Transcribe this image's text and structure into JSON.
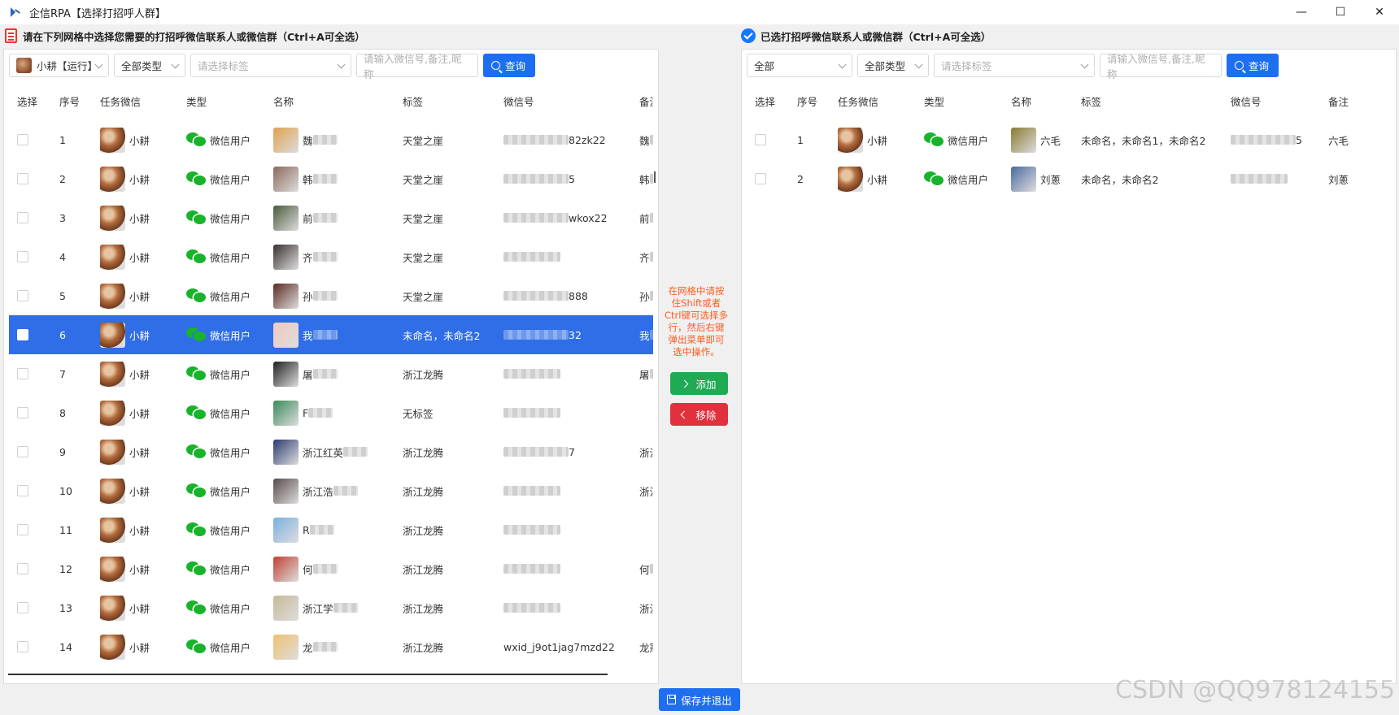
{
  "window": {
    "title": "企信RPA【选择打招呼人群】",
    "min_glyph": "—",
    "max_glyph": "☐",
    "close_glyph": "✕"
  },
  "left": {
    "header": "请在下列网格中选择您需要的打招呼微信联系人或微信群（Ctrl+A可全选）",
    "filters": {
      "account": "小耕【运行】",
      "type": "全部类型",
      "tag_placeholder": "请选择标签",
      "search_placeholder": "请输入微信号,备注,昵称",
      "query_label": "查询"
    },
    "columns": [
      "选择",
      "序号",
      "任务微信",
      "类型",
      "名称",
      "标签",
      "微信号",
      "备注"
    ],
    "rows": [
      {
        "no": "1",
        "task": "小耕",
        "type": "微信用户",
        "name": "魏",
        "tag": "天堂之崖",
        "wxid": "82zk22",
        "remark": "魏",
        "avatar": "#e0a050"
      },
      {
        "no": "2",
        "task": "小耕",
        "type": "微信用户",
        "name": "韩",
        "tag": "天堂之崖",
        "wxid": "5",
        "remark": "韩",
        "avatar": "#8a6a5a"
      },
      {
        "no": "3",
        "task": "小耕",
        "type": "微信用户",
        "name": "前",
        "tag": "天堂之崖",
        "wxid": "wkox22",
        "remark": "前",
        "avatar": "#4a5a3a"
      },
      {
        "no": "4",
        "task": "小耕",
        "type": "微信用户",
        "name": "齐",
        "tag": "天堂之崖",
        "wxid": "",
        "remark": "齐",
        "avatar": "#3a3030"
      },
      {
        "no": "5",
        "task": "小耕",
        "type": "微信用户",
        "name": "孙",
        "tag": "天堂之崖",
        "wxid": "888",
        "remark": "孙",
        "avatar": "#5a2a20"
      },
      {
        "no": "6",
        "task": "小耕",
        "type": "微信用户",
        "name": "我",
        "tag": "未命名，未命名2",
        "wxid": "32",
        "remark": "我",
        "avatar": "#f2c8c0"
      },
      {
        "no": "7",
        "task": "小耕",
        "type": "微信用户",
        "name": "屠",
        "tag": "浙江龙腾",
        "wxid": "",
        "remark": "屠",
        "avatar": "#202020"
      },
      {
        "no": "8",
        "task": "小耕",
        "type": "微信用户",
        "name": "F",
        "tag": "无标签",
        "wxid": "",
        "remark": "",
        "avatar": "#3a8a5a"
      },
      {
        "no": "9",
        "task": "小耕",
        "type": "微信用户",
        "name": "浙江红英",
        "tag": "浙江龙腾",
        "wxid": "7",
        "remark": "浙江龙腾-",
        "avatar": "#2a3a70"
      },
      {
        "no": "10",
        "task": "小耕",
        "type": "微信用户",
        "name": "浙江浩",
        "tag": "浙江龙腾",
        "wxid": "",
        "remark": "浙江龙腾-",
        "avatar": "#5a4a4a"
      },
      {
        "no": "11",
        "task": "小耕",
        "type": "微信用户",
        "name": "R",
        "tag": "浙江龙腾",
        "wxid": "",
        "remark": "",
        "avatar": "#7ab0e0"
      },
      {
        "no": "12",
        "task": "小耕",
        "type": "微信用户",
        "name": "何",
        "tag": "浙江龙腾",
        "wxid": "",
        "remark": "何",
        "avatar": "#c04030"
      },
      {
        "no": "13",
        "task": "小耕",
        "type": "微信用户",
        "name": "浙江学",
        "tag": "浙江龙腾",
        "wxid": "",
        "remark": "浙江龙腾-",
        "avatar": "#c8b898"
      },
      {
        "no": "14",
        "task": "小耕",
        "type": "微信用户",
        "name": "龙",
        "tag": "浙江龙腾",
        "wxid": "wxid_j9ot1jag7mzd22",
        "remark": "龙冠",
        "avatar": "#f0c070"
      }
    ]
  },
  "right": {
    "header": "已选打招呼微信联系人或微信群（Ctrl+A可全选）",
    "filters": {
      "account": "全部",
      "type": "全部类型",
      "tag_placeholder": "请选择标签",
      "search_placeholder": "请输入微信号,备注,昵称",
      "query_label": "查询"
    },
    "columns": [
      "选择",
      "序号",
      "任务微信",
      "类型",
      "名称",
      "标签",
      "微信号",
      "备注"
    ],
    "rows": [
      {
        "no": "1",
        "task": "小耕",
        "type": "微信用户",
        "name": "六毛",
        "tag": "未命名，未命名1，未命名2",
        "wxid": "5",
        "remark": "六毛",
        "avatar": "#8a7a30"
      },
      {
        "no": "2",
        "task": "小耕",
        "type": "微信用户",
        "name": "刘蔥",
        "tag": "未命名，未命名2",
        "wxid": "",
        "remark": "刘蔥",
        "avatar": "#4a6aa0"
      }
    ]
  },
  "middle": {
    "hint": "在网格中请按住Shift或者Ctrl键可选择多行，然后右键弹出菜单即可选中操作。",
    "add_label": "添加",
    "remove_label": "移除"
  },
  "footer": {
    "save_label": "保存并退出"
  },
  "watermark": "CSDN @QQ978124155",
  "colors": {
    "primary": "#1e6ff0",
    "selected_row": "#2f6ee6",
    "add": "#1faa53",
    "remove": "#e1303e",
    "hint": "#ff5a1f",
    "wechat": "#18b32b"
  }
}
